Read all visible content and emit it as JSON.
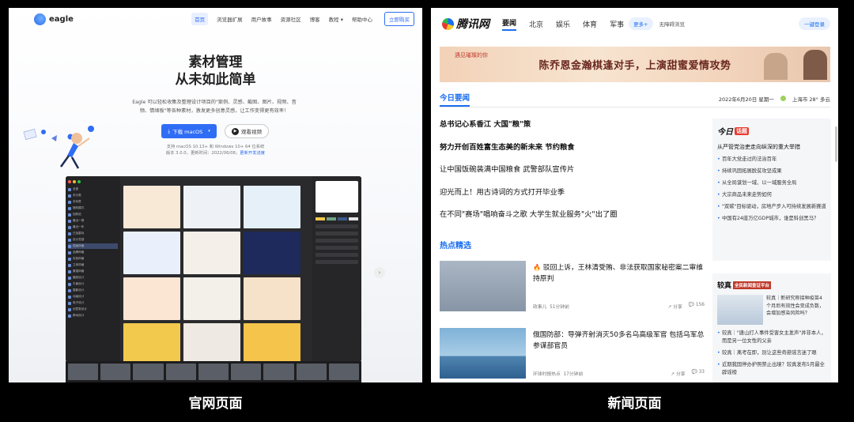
{
  "left_caption": "官网页面",
  "right_caption": "新闻页面",
  "eagle": {
    "logo_text": "eagle",
    "nav": [
      "首页",
      "浏览器扩展",
      "用户故事",
      "资源社区",
      "博客",
      "教程 ▾",
      "帮助中心"
    ],
    "buy_label": "立即购买",
    "title_line1": "素材管理",
    "title_line2": "从未如此简单",
    "desc_line1": "Eagle 可以轻松收集及整理设计项目的\"案例、灵感、截图、图片、视频、音",
    "desc_line2": "频、情绪板\"等各种素材，激发更多创意灵感，让工作变得更有效率！",
    "download_label": "下载 macOS",
    "video_label": "观看视频",
    "sys_line1": "支持 macOS 10.13+ 和 Windows 10+ 64 位系统",
    "sys_line2_prefix": "版本 3.0.0，更新时间：2022/06/08，",
    "sys_link": "更新开发进度",
    "app_sidebar": [
      "全部",
      "未分类",
      "未标签",
      "随机模式",
      "回收站",
      "最近一周",
      "最近一年",
      "已加星标",
      "设计灵感",
      "插画风格",
      "品牌风格",
      "实验风格",
      "立体风格",
      "素描风格",
      "播放设计",
      "平面设计",
      "摄影设计",
      "动画设计",
      "电子设计",
      "创意类设计",
      "移动设计"
    ],
    "colors": {
      "primary": "#2f6df5"
    }
  },
  "news": {
    "logo_text": "腾讯网",
    "tabs": [
      "要闻",
      "北京",
      "娱乐",
      "体育",
      "军事"
    ],
    "more_label": "更多+",
    "access_label": "无障碍浏览",
    "oneclick_label": "一键登录",
    "banner_tag": "遇见璀璨的你",
    "banner_text": "陈乔恩金瀚棋逢对手，上演甜蜜爱情攻势",
    "today_label": "今日要闻",
    "date_text": "2022年6月20日 星期一",
    "weather_text": "上海市 28° 多云",
    "headlines": [
      {
        "text": "总书记心系香江 大国\"粮\"策",
        "bold": true
      },
      {
        "text": "努力开创百姓富生态美的新未来 节约粮食",
        "bold": true
      },
      {
        "text": "让中国饭碗装满中国粮食 武警部队宣传片",
        "bold": false
      },
      {
        "text": "迎光而上！用古诗词的方式打开毕业季",
        "bold": false
      },
      {
        "text": "在不同\"赛场\"唱响奋斗之歌 大学生就业服务\"火\"出了圈",
        "bold": false
      }
    ],
    "hot_label": "热点精选",
    "cards": [
      {
        "title": "驳回上诉，王林清受贿、非法获取国家秘密案二审维持原判",
        "source": "政事儿",
        "time": "51分钟前",
        "share": "分享",
        "comments": "156"
      },
      {
        "title": "俄国防部：导弹齐射消灭50多名乌高级军官 包括乌军总参谋部官员",
        "source": "环球时报热点",
        "time": "17分钟前",
        "share": "分享",
        "comments": "33"
      }
    ],
    "side1": {
      "logo_main": "今日",
      "logo_badge": "话题",
      "lead": "从严管党治吏走向纵深的重大举措",
      "items": [
        "百年大党走过的法治百年",
        "持续巩固拓展脱贫攻坚成果",
        "从全局谋划一域、以一域服务全局",
        "大宗商品未来走势如何",
        "\"双碳\"目标驱动，房地产步入可持续发展新赛道",
        "中国有24座万亿GDP城市，谁是科创黑马？"
      ]
    },
    "side2": {
      "logo_main": "较真",
      "logo_sub": "全民新闻查证平台",
      "feature": "较真｜新研究称接种疫苗4个月后有效性会变成负数，会增加感染风险吗？",
      "items": [
        "较真｜\"唐山打人事件受害女主发声\"并非本人，而是另一位女性的父亲",
        "较真｜离考在即，别让这些奇葩谣言迷了眼",
        "近期我国停办护照禁止出境？较真发布5月最全辟谣榜"
      ]
    },
    "colors": {
      "primary": "#1a6ef0"
    }
  }
}
